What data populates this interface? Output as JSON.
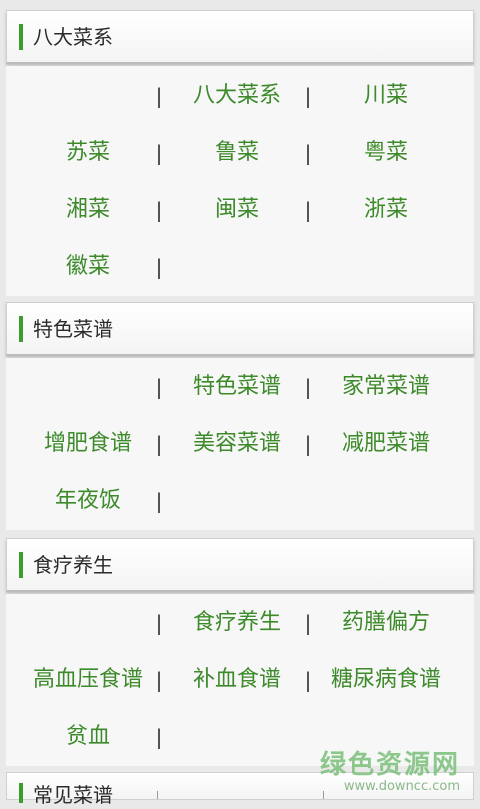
{
  "sections": [
    {
      "title": "八大菜系",
      "rows": [
        [
          "",
          "八大菜系",
          "川菜"
        ],
        [
          "苏菜",
          "鲁菜",
          "粤菜"
        ],
        [
          "湘菜",
          "闽菜",
          "浙菜"
        ],
        [
          "徽菜",
          "",
          ""
        ]
      ]
    },
    {
      "title": "特色菜谱",
      "rows": [
        [
          "",
          "特色菜谱",
          "家常菜谱"
        ],
        [
          "增肥食谱",
          "美容菜谱",
          "减肥菜谱"
        ],
        [
          "年夜饭",
          "",
          ""
        ]
      ]
    },
    {
      "title": "食疗养生",
      "rows": [
        [
          "",
          "食疗养生",
          "药膳偏方"
        ],
        [
          "高血压食谱",
          "补血食谱",
          "糖尿病食谱"
        ],
        [
          "贫血",
          "",
          ""
        ]
      ]
    }
  ],
  "next_section_title": "常见菜谱",
  "separator": "|",
  "watermark": {
    "main": "绿色资源网",
    "sub": "www.downcc.com"
  },
  "colors": {
    "accent": "#3e9b2e",
    "item_text": "#3d8a2a"
  }
}
